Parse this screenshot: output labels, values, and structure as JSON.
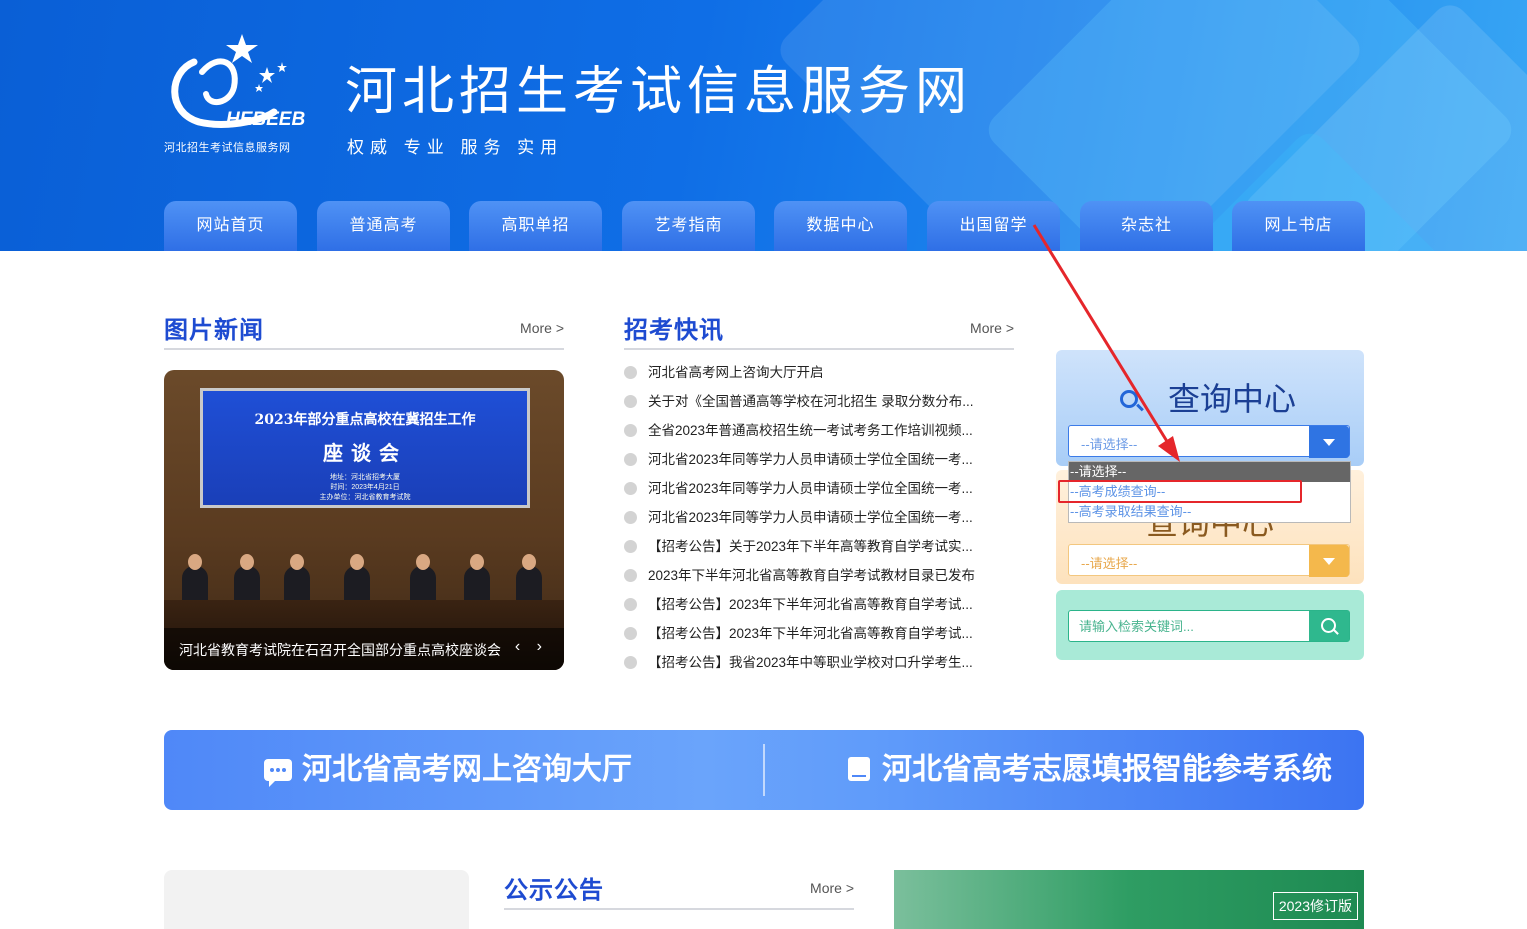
{
  "header": {
    "logo_text": "HEBEEB",
    "logo_subtitle": "河北招生考试信息服务网",
    "site_title": "河北招生考试信息服务网",
    "slogan": "权威 专业 服务 实用"
  },
  "nav": [
    {
      "label": "网站首页"
    },
    {
      "label": "普通高考"
    },
    {
      "label": "高职单招"
    },
    {
      "label": "艺考指南"
    },
    {
      "label": "数据中心"
    },
    {
      "label": "出国留学"
    },
    {
      "label": "杂志社"
    },
    {
      "label": "网上书店"
    }
  ],
  "photo_news": {
    "title": "图片新闻",
    "more": "More >",
    "slide": {
      "screen_line1": "2023年部分重点高校在冀招生工作",
      "screen_line2": "座谈会",
      "screen_line3a": "地址：河北省招考大厦",
      "screen_line3b": "时间：2023年4月21日",
      "screen_line3c": "主办单位：河北省教育考试院",
      "caption": "河北省教育考试院在石召开全国部分重点高校座谈会",
      "arrows": "‹ ›"
    }
  },
  "exam_news": {
    "title": "招考快讯",
    "more": "More >",
    "items": [
      "河北省高考网上咨询大厅开启",
      "关于对《全国普通高等学校在河北招生 录取分数分布...",
      "全省2023年普通高校招生统一考试考务工作培训视频...",
      "河北省2023年同等学力人员申请硕士学位全国统一考...",
      "河北省2023年同等学力人员申请硕士学位全国统一考...",
      "河北省2023年同等学力人员申请硕士学位全国统一考...",
      "【招考公告】关于2023年下半年高等教育自学考试实...",
      "2023年下半年河北省高等教育自学考试教材目录已发布",
      "【招考公告】2023年下半年河北省高等教育自学考试...",
      "【招考公告】2023年下半年河北省高等教育自学考试...",
      "【招考公告】我省2023年中等职业学校对口升学考生..."
    ]
  },
  "query_center": {
    "title": "查询中心",
    "select_value": "--请选择--",
    "dropdown_options": [
      "--请选择--",
      "--高考成绩查询--",
      "--高考录取结果查询--"
    ],
    "select2_value": "--请选择--",
    "search_placeholder": "请输入检索关键词..."
  },
  "banner": {
    "left": "河北省高考网上咨询大厅",
    "right": "河北省高考志愿填报智能参考系统"
  },
  "notice": {
    "title": "公示公告",
    "more": "More >"
  },
  "book_promo": {
    "edition": "2023修订版"
  },
  "colors": {
    "header_blue": "#0f6ee6",
    "nav_blue": "#2f6fe6",
    "section_title": "#1e4bd1",
    "highlight_red": "#e5262b"
  }
}
